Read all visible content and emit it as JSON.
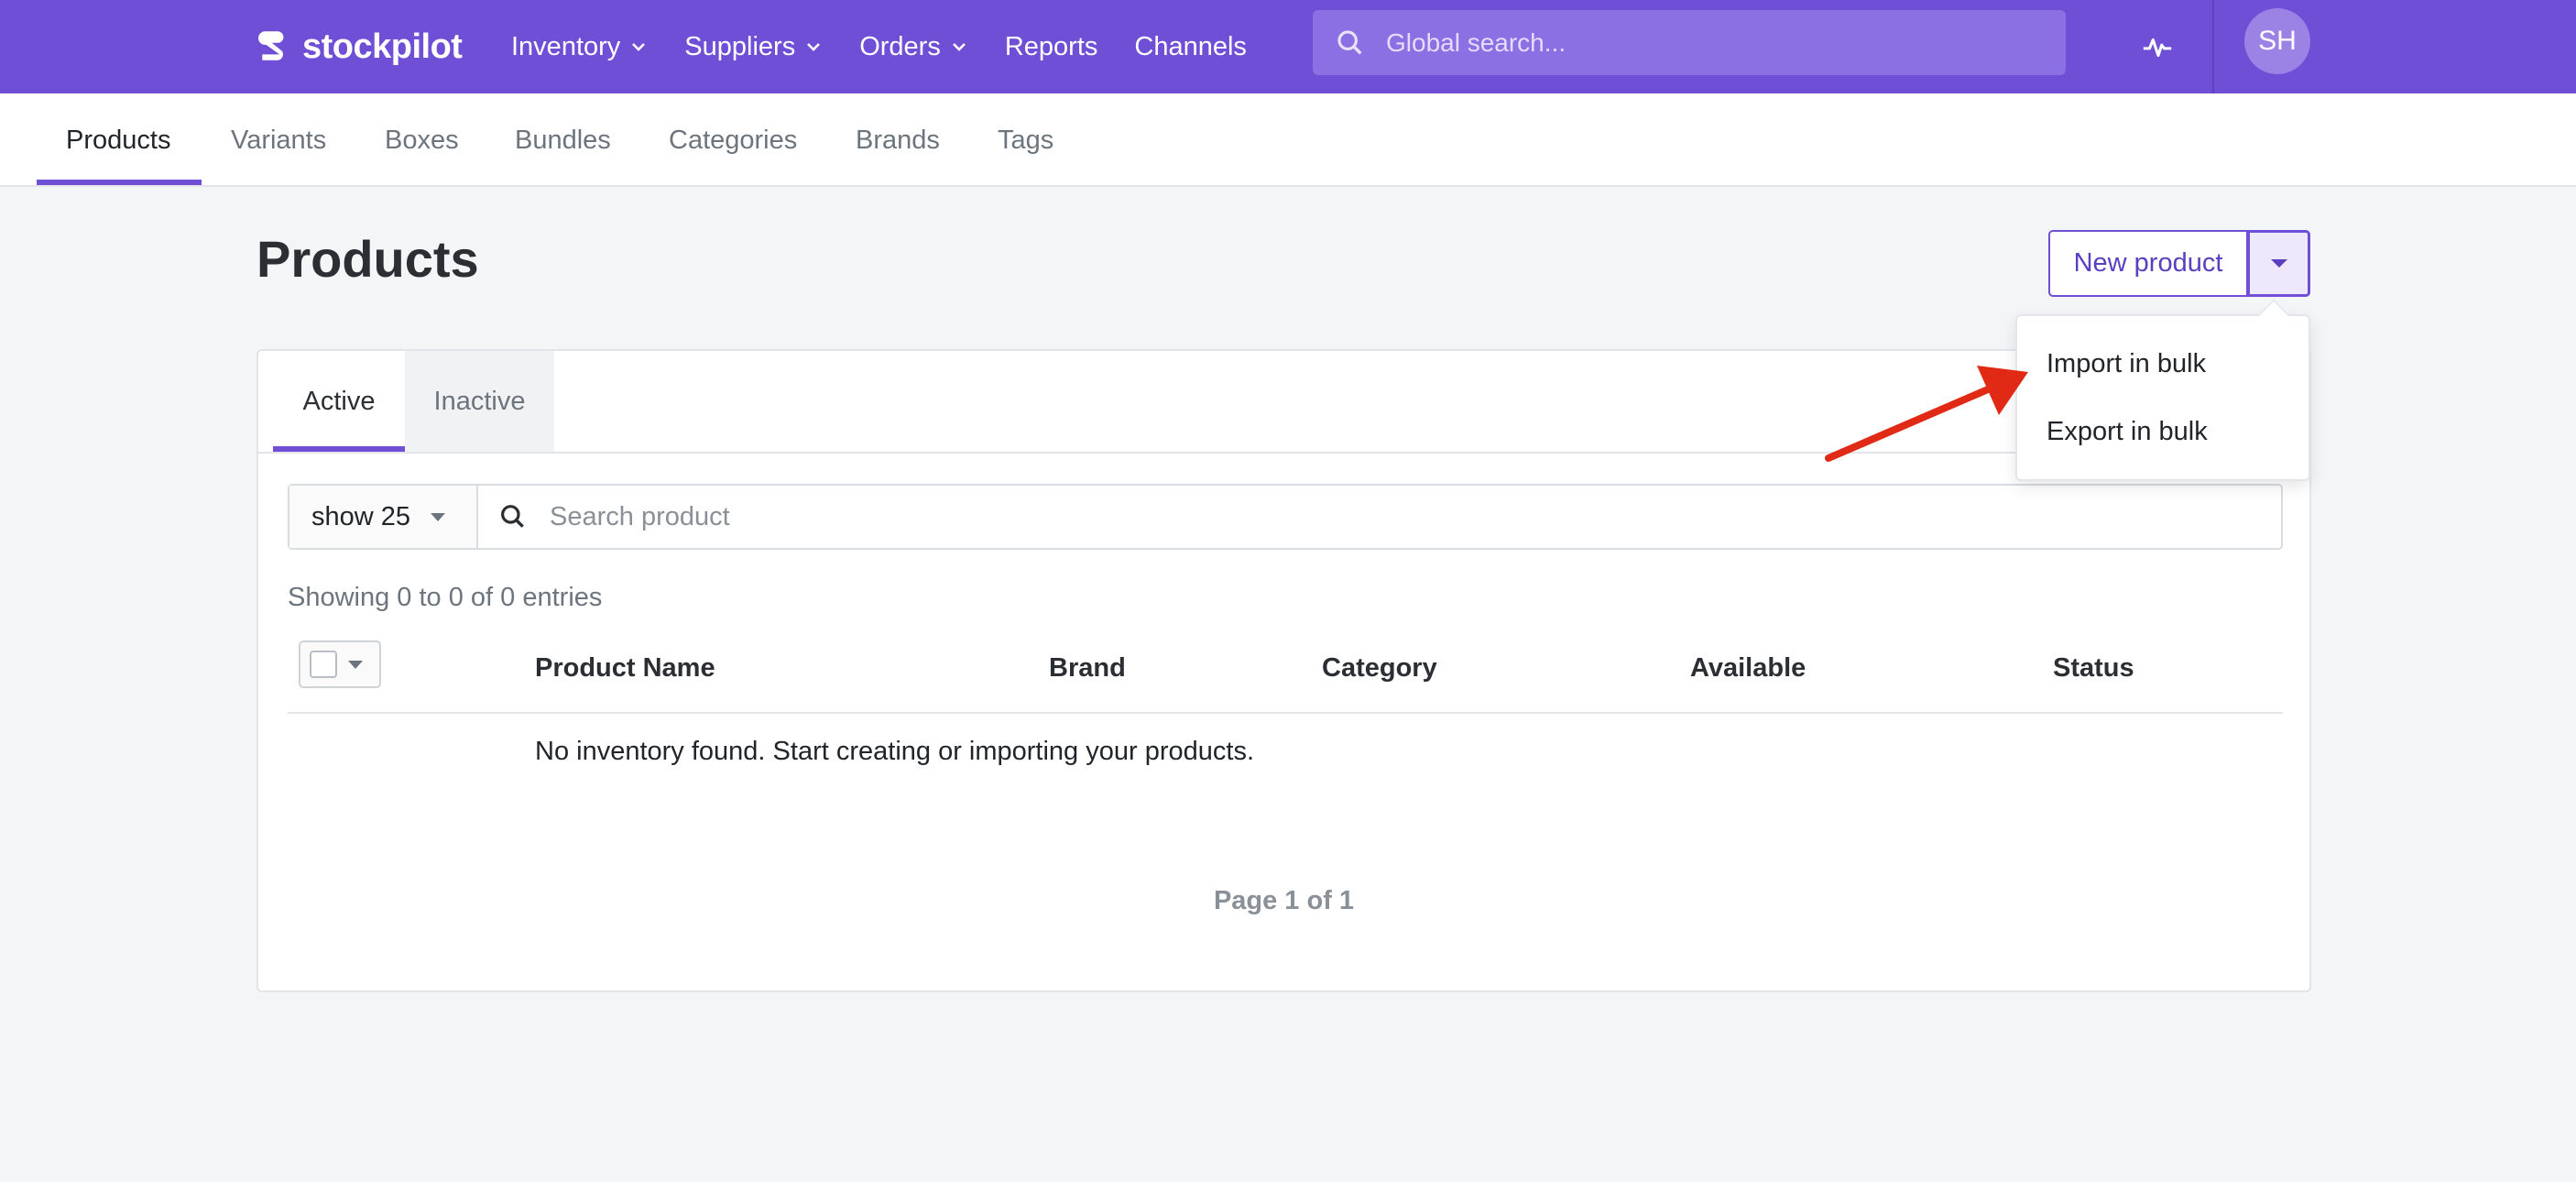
{
  "brand": {
    "name": "stockpilot"
  },
  "topnav": {
    "items": [
      {
        "label": "Inventory",
        "has_dropdown": true
      },
      {
        "label": "Suppliers",
        "has_dropdown": true
      },
      {
        "label": "Orders",
        "has_dropdown": true
      },
      {
        "label": "Reports",
        "has_dropdown": false
      },
      {
        "label": "Channels",
        "has_dropdown": false
      }
    ],
    "search_placeholder": "Global search...",
    "avatar_initials": "SH",
    "activity_icon": "pulse-icon"
  },
  "subnav": {
    "tabs": [
      {
        "label": "Products",
        "active": true
      },
      {
        "label": "Variants"
      },
      {
        "label": "Boxes"
      },
      {
        "label": "Bundles"
      },
      {
        "label": "Categories"
      },
      {
        "label": "Brands"
      },
      {
        "label": "Tags"
      }
    ]
  },
  "page": {
    "title": "Products",
    "new_button_label": "New product",
    "dropdown_items": [
      "Import in bulk",
      "Export in bulk"
    ]
  },
  "card": {
    "tabs": [
      "Active",
      "Inactive"
    ],
    "page_size_label": "show 25",
    "search_placeholder": "Search product",
    "showing_text": "Showing 0 to 0 of 0 entries",
    "columns": [
      "Product Name",
      "Brand",
      "Category",
      "Available",
      "Status"
    ],
    "empty_message": "No inventory found. Start creating or importing your products.",
    "pagination_text": "Page 1 of 1"
  },
  "colors": {
    "brand_purple": "#6e4fd6",
    "annotation_arrow": "#e02a16"
  }
}
